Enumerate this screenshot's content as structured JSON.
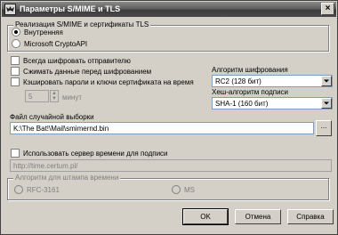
{
  "window": {
    "title": "Параметры S/MIME и TLS",
    "close_glyph": "×"
  },
  "implementation_group": {
    "legend": "Реализация S/MIME и сертификаты TLS",
    "options": [
      {
        "label": "Внутренняя",
        "checked": true
      },
      {
        "label": "Microsoft CryptoAPI",
        "checked": false
      }
    ]
  },
  "checkboxes": {
    "always_encrypt": "Всегда шифровать отправителю",
    "compress": "Сжимать данные перед шифрованием",
    "cache_passwords": "Кэшировать пароли и ключи сертификата на время"
  },
  "cache_time": {
    "value": "5",
    "unit": "минут"
  },
  "cipher": {
    "label": "Алгоритм шифрования",
    "value": "RC2 (128 бит)"
  },
  "hash": {
    "label": "Хеш-алгоритм подписи",
    "value": "SHA-1 (160 бит)"
  },
  "random_file": {
    "label": "Файл случайной выборки",
    "value": "K:\\The Bat!\\Mail\\smimernd.bin",
    "browse_label": "..."
  },
  "timestamp": {
    "checkbox_label": "Использовать сервер времени для подписи",
    "server_placeholder": "http://time.certum.pl/"
  },
  "timestamp_group": {
    "legend": "Алгоритм для штампа времени",
    "options": [
      {
        "label": "RFC-3161"
      },
      {
        "label": "MS"
      }
    ]
  },
  "buttons": {
    "ok": "OK",
    "cancel": "Отмена",
    "help": "Справка"
  }
}
